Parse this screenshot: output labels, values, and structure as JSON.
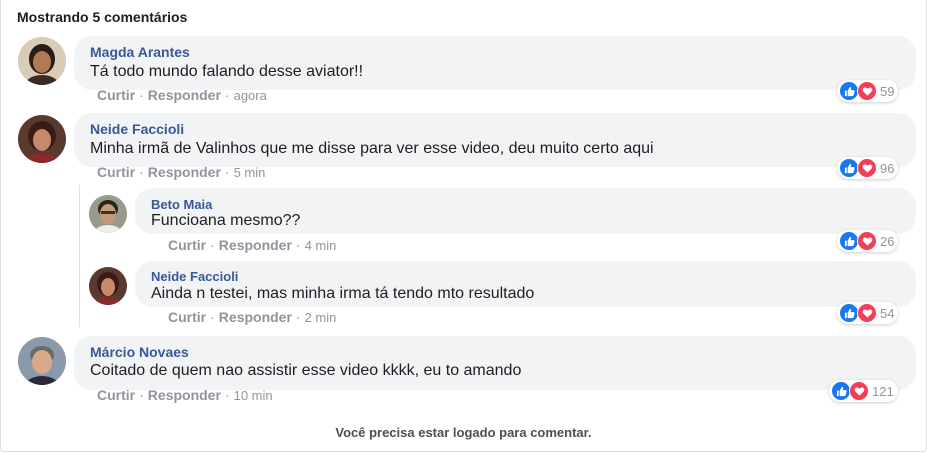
{
  "header": {
    "title": "Mostrando 5 comentários"
  },
  "actions": {
    "like": "Curtir",
    "reply": "Responder",
    "sep": "·"
  },
  "comments": [
    {
      "name": "Magda Arantes",
      "text": "Tá todo mundo falando desse aviator!!",
      "time": "agora",
      "count": "59",
      "avatar_color": "#b07a55"
    },
    {
      "name": "Neide Faccioli",
      "text": "Minha irmã de Valinhos que me disse para ver esse video, deu muito certo aqui",
      "time": "5 min",
      "count": "96",
      "avatar_color": "#7a4a3a"
    },
    {
      "name": "Beto Maia",
      "text": "Funcioana mesmo??",
      "time": "4 min",
      "count": "26",
      "avatar_color": "#8a7a6a"
    },
    {
      "name": "Neide Faccioli",
      "text": "Ainda n testei, mas minha irma tá tendo mto resultado",
      "time": "2 min",
      "count": "54",
      "avatar_color": "#7a4a3a"
    },
    {
      "name": "Márcio Novaes",
      "text": "Coitado de quem nao assistir esse video kkkk, eu to amando",
      "time": "10 min",
      "count": "121",
      "avatar_color": "#9a8a7a"
    }
  ],
  "footer": {
    "text": "Você precisa estar logado para comentar."
  },
  "colors": {
    "name": "#385898",
    "like": "#1877f2",
    "love": "#f33e58",
    "bubble": "#f2f3f5"
  },
  "icons": {
    "like": "thumbs-up-icon",
    "love": "heart-icon"
  }
}
